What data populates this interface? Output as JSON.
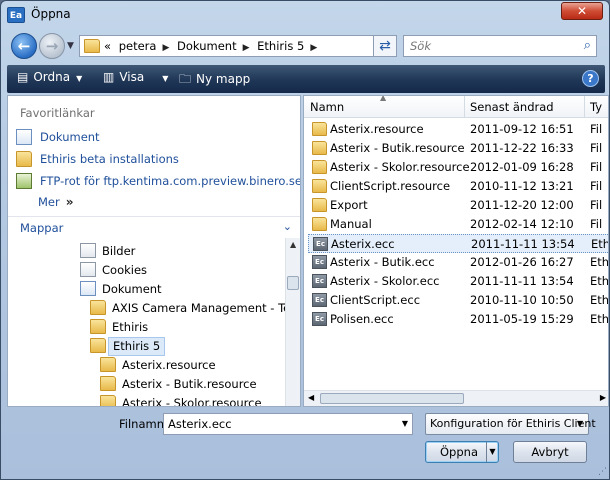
{
  "window": {
    "title": "Öppna",
    "app_icon_text": "Ea",
    "close_label": "✕"
  },
  "address": {
    "prefix": "«",
    "crumbs": [
      "petera",
      "Dokument",
      "Ethiris 5"
    ],
    "search_placeholder": "Sök"
  },
  "toolbar": {
    "organize": "Ordna",
    "view": "Visa",
    "new_folder": "Ny mapp",
    "help": "?"
  },
  "left": {
    "favorites_header": "Favoritlänkar",
    "favorites": [
      {
        "label": "Dokument",
        "icon": "documents-icon"
      },
      {
        "label": "Ethiris beta installations",
        "icon": "folder-icon"
      },
      {
        "label": "FTP-rot för ftp.kentima.com.preview.binero.se",
        "icon": "ftp-icon"
      }
    ],
    "more": "Mer",
    "more_chevron": "»",
    "folders_header": "Mappar",
    "tree": [
      {
        "label": "Bilder",
        "icon": "pictures-icon"
      },
      {
        "label": "Cookies",
        "icon": "cookies-icon"
      },
      {
        "label": "Dokument",
        "icon": "documents-icon"
      },
      {
        "label": "AXIS Camera Management - Ter",
        "icon": "folder-icon"
      },
      {
        "label": "Ethiris",
        "icon": "folder-icon"
      },
      {
        "label": "Ethiris 5",
        "icon": "folder-icon",
        "selected": true
      },
      {
        "label": "Asterix.resource",
        "icon": "folder-icon"
      },
      {
        "label": "Asterix - Butik.resource",
        "icon": "folder-icon"
      },
      {
        "label": "Asterix - Skolor.resource",
        "icon": "folder-icon"
      }
    ]
  },
  "files": {
    "columns": [
      "Namn",
      "Senast ändrad",
      "Ty"
    ],
    "rows": [
      {
        "name": "Asterix.resource",
        "date": "2011-09-12 16:51",
        "type": "Fil",
        "kind": "folder"
      },
      {
        "name": "Asterix - Butik.resource",
        "date": "2011-12-22 16:33",
        "type": "Fil",
        "kind": "folder"
      },
      {
        "name": "Asterix - Skolor.resource",
        "date": "2012-01-09 16:28",
        "type": "Fil",
        "kind": "folder"
      },
      {
        "name": "ClientScript.resource",
        "date": "2010-11-12 13:21",
        "type": "Fil",
        "kind": "folder"
      },
      {
        "name": "Export",
        "date": "2011-12-20 12:00",
        "type": "Fil",
        "kind": "folder"
      },
      {
        "name": "Manual",
        "date": "2012-02-14 12:10",
        "type": "Fil",
        "kind": "folder"
      },
      {
        "name": "Asterix.ecc",
        "date": "2011-11-11 13:54",
        "type": "Eth",
        "kind": "ecc",
        "selected": true
      },
      {
        "name": "Asterix - Butik.ecc",
        "date": "2012-01-26 16:27",
        "type": "Eth",
        "kind": "ecc"
      },
      {
        "name": "Asterix - Skolor.ecc",
        "date": "2011-11-11 13:54",
        "type": "Eth",
        "kind": "ecc"
      },
      {
        "name": "ClientScript.ecc",
        "date": "2010-11-10 10:50",
        "type": "Eth",
        "kind": "ecc"
      },
      {
        "name": "Polisen.ecc",
        "date": "2011-05-19 15:29",
        "type": "Eth",
        "kind": "ecc"
      }
    ],
    "ecc_icon_text": "Ec"
  },
  "bottom": {
    "filename_label": "Filnamn:",
    "filename_value": "Asterix.ecc",
    "filter_value": "Konfiguration för Ethiris Client",
    "open_label": "Öppna",
    "cancel_label": "Avbryt"
  }
}
